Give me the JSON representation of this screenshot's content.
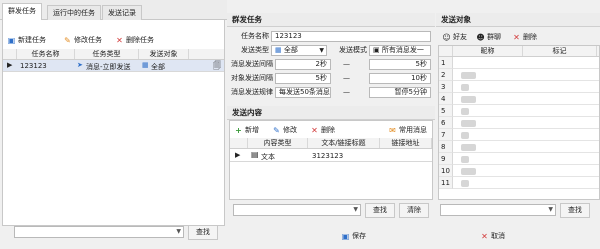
{
  "left": {
    "tabs": [
      {
        "label": "群发任务"
      },
      {
        "label": "运行中的任务"
      },
      {
        "label": "发送记录"
      }
    ],
    "toolbar": {
      "new": "新建任务",
      "edit": "修改任务",
      "delete": "删除任务"
    },
    "columns": [
      "任务名称",
      "任务类型",
      "发送对象"
    ],
    "rows": [
      {
        "name": "123123",
        "type": "消息-立即发送",
        "target": "全部"
      }
    ],
    "search_button": "查找"
  },
  "middle": {
    "section_title": "群发任务",
    "task_name_label": "任务名称",
    "task_name_value": "123123",
    "send_type_label": "发送类型",
    "send_type_value": "全部",
    "send_mode_label": "发送模式",
    "send_mode_value": "所有消息发一",
    "interval_label": "消息发送间隔",
    "interval_from": "2秒",
    "interval_to": "5秒",
    "target_interval_label": "对象发送间隔",
    "target_interval_from": "5秒",
    "target_interval_to": "10秒",
    "rule_label": "消息发送规律",
    "rule_value": "每发送50条消息",
    "rule_pause": "暂停5分钟",
    "dash": "—",
    "content_title": "发送内容",
    "content_toolbar": {
      "add": "新增",
      "edit": "修改",
      "delete": "删除",
      "common": "常用消息"
    },
    "content_columns": [
      "内容类型",
      "文本/链接标题",
      "链接地址"
    ],
    "content_rows": [
      {
        "type": "文本",
        "title": "3123123",
        "url": ""
      }
    ],
    "search_button": "查找",
    "clear_button": "清除"
  },
  "right": {
    "section_title": "发送对象",
    "toolbar": {
      "friend": "好友",
      "group": "群聊",
      "delete": "删除"
    },
    "columns": [
      "昵称",
      "标记"
    ],
    "row_numbers": [
      "1",
      "2",
      "3",
      "4",
      "5",
      "6",
      "7",
      "8",
      "9",
      "10",
      "11"
    ],
    "search_button": "查找"
  },
  "footer": {
    "save": "保存",
    "cancel": "取消"
  },
  "colors": {
    "accent": "#2e6fc9",
    "green": "#3a9a3a",
    "red": "#d23a3a",
    "orange": "#e28a1e"
  }
}
